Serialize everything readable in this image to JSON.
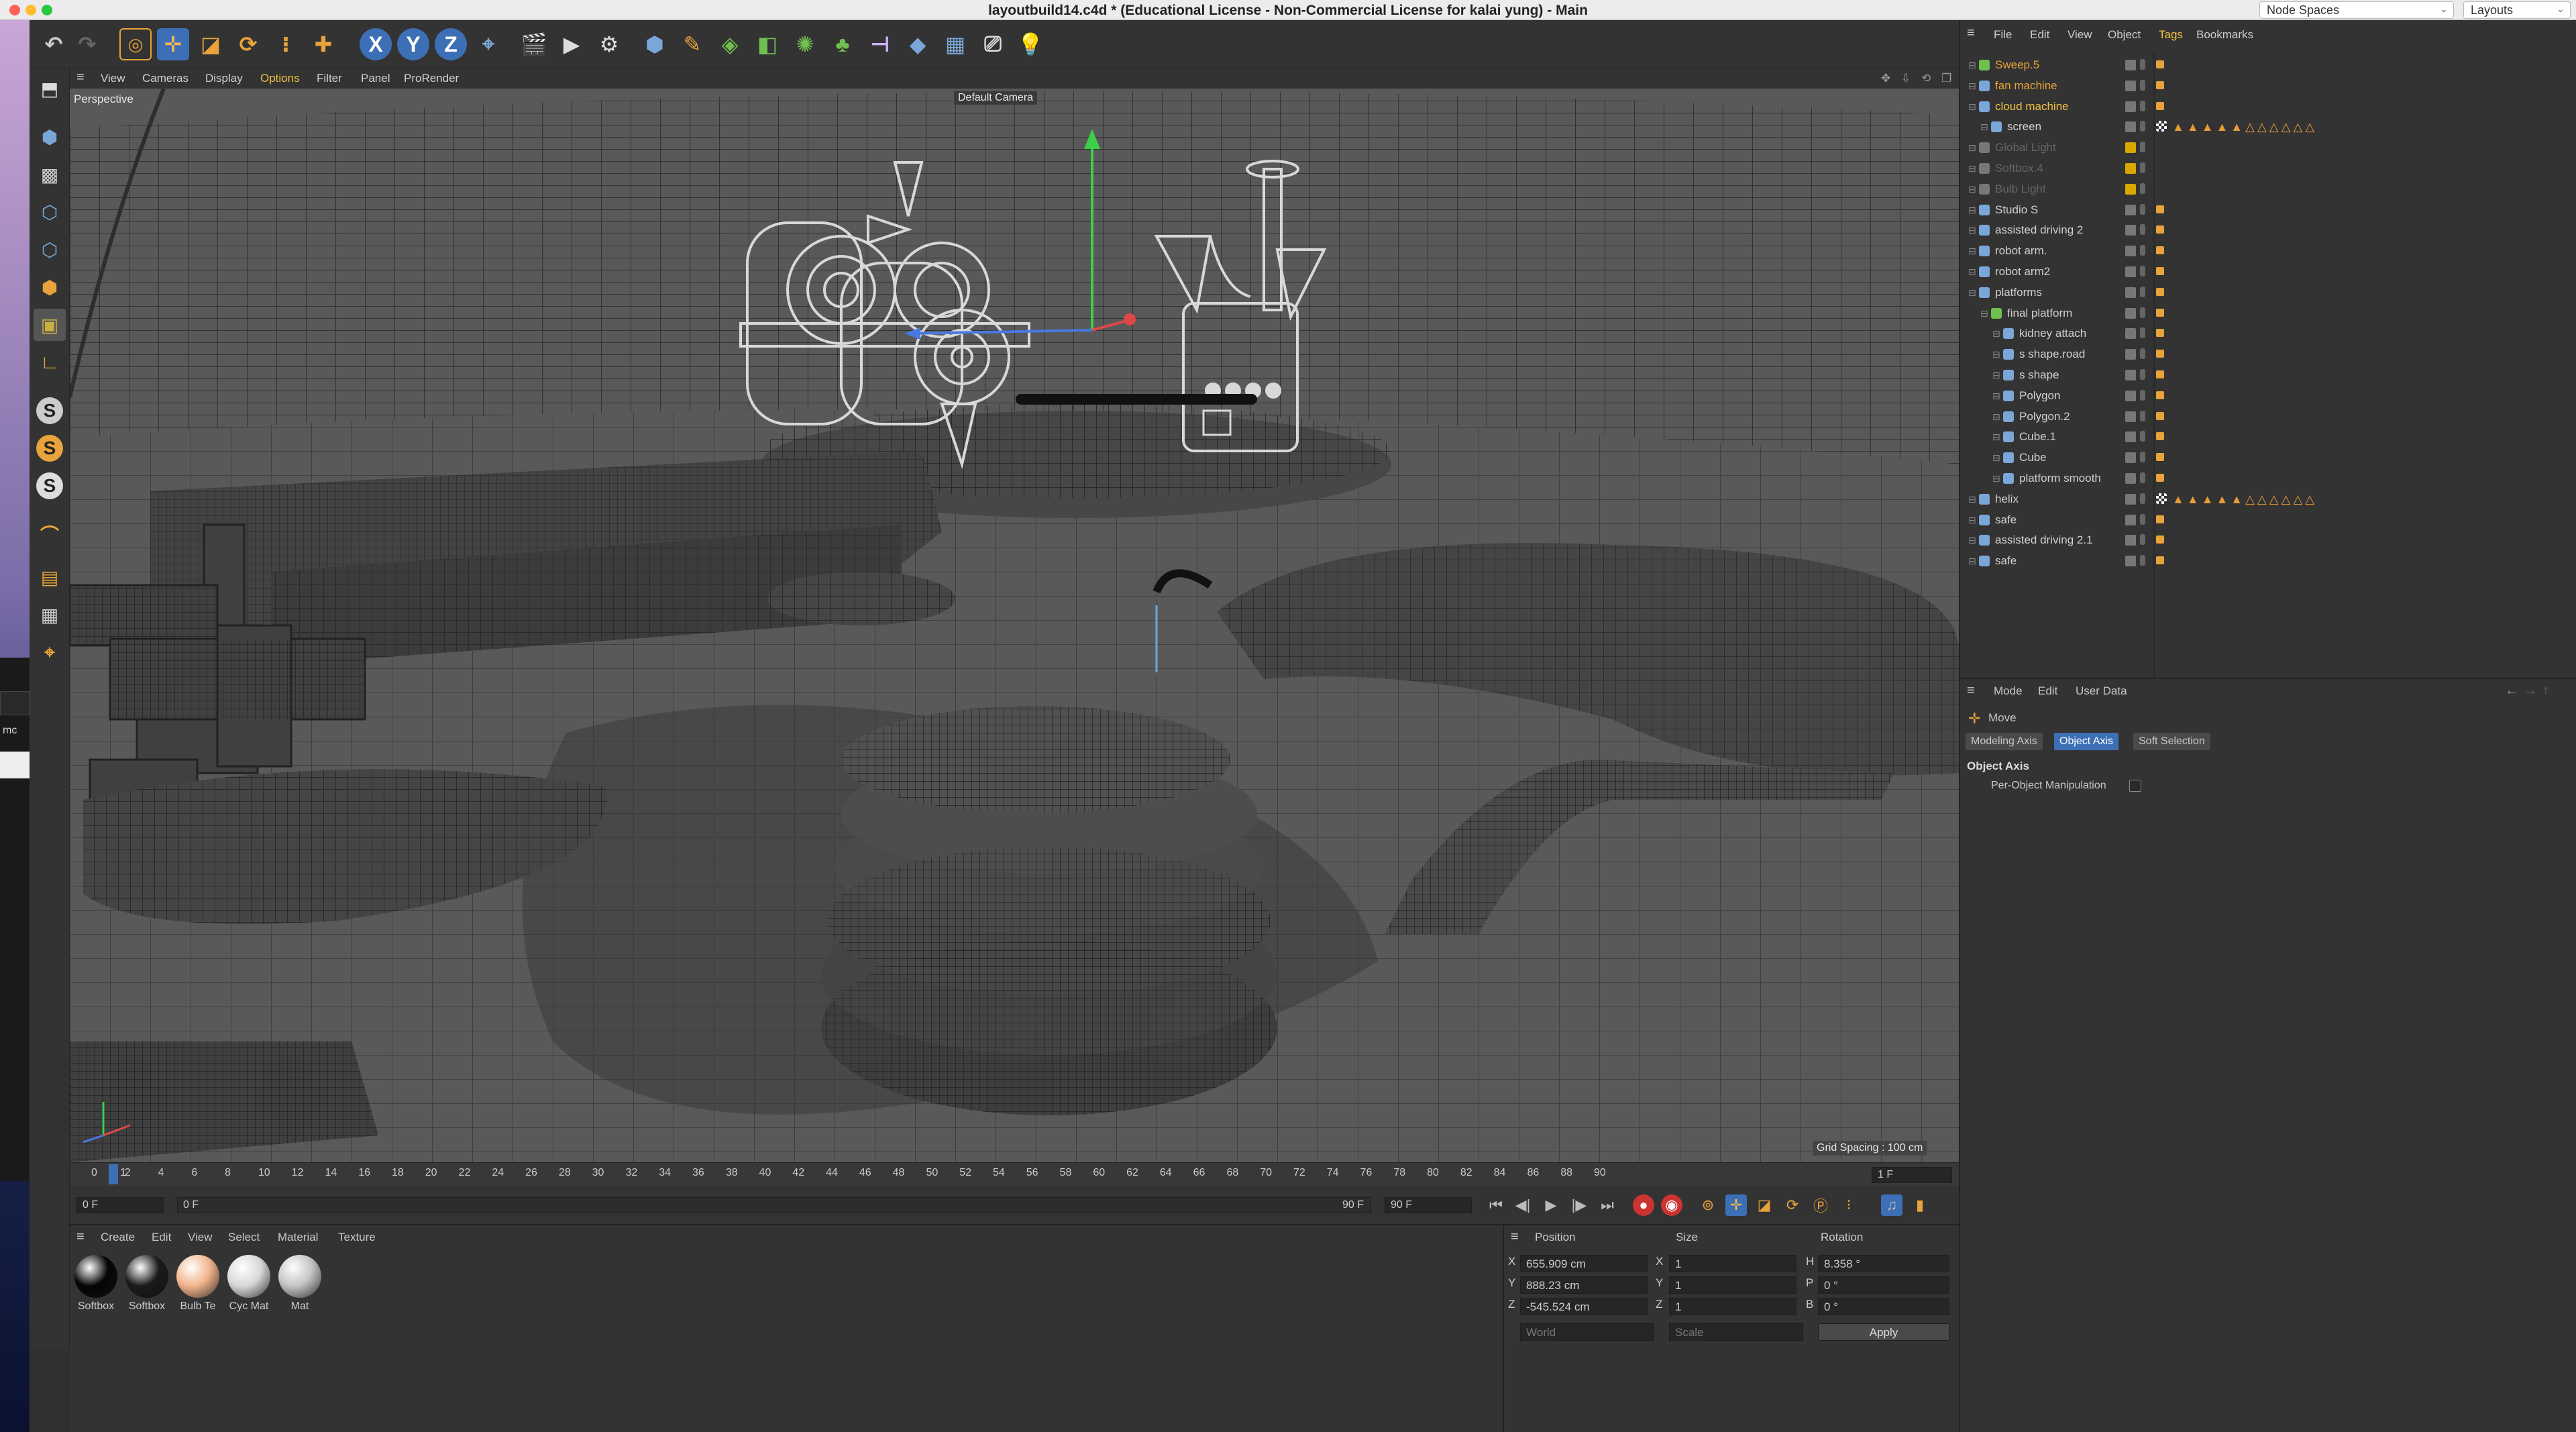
{
  "titlebar": {
    "title": "layoutbuild14.c4d * (Educational License - Non-Commercial License for kalai yung) - Main",
    "node_spaces": "Node Spaces",
    "layouts": "Layouts"
  },
  "toolbar": {
    "axis_x": "X",
    "axis_y": "Y",
    "axis_z": "Z"
  },
  "left_toolbar": {
    "s_label": "S"
  },
  "desktop": {
    "snippet": "mc"
  },
  "viewport": {
    "menu": [
      "View",
      "Cameras",
      "Display",
      "Options",
      "Filter",
      "Panel",
      "ProRender"
    ],
    "label": "Perspective",
    "camera": "Default Camera",
    "grid_spacing": "Grid Spacing : 100 cm"
  },
  "timeline": {
    "ticks": [
      "0",
      "2",
      "4",
      "6",
      "8",
      "10",
      "12",
      "14",
      "16",
      "18",
      "20",
      "22",
      "24",
      "26",
      "28",
      "30",
      "32",
      "34",
      "36",
      "38",
      "40",
      "42",
      "44",
      "46",
      "48",
      "50",
      "52",
      "54",
      "56",
      "58",
      "60",
      "62",
      "64",
      "66",
      "68",
      "70",
      "72",
      "74",
      "76",
      "78",
      "80",
      "82",
      "84",
      "86",
      "88",
      "90"
    ],
    "current_marker": "1",
    "current_frame_field": "1 F",
    "start_field": "0 F",
    "min_field": "0 F",
    "end_field": "90 F",
    "max_field": "90 F"
  },
  "materials": {
    "menu": [
      "Create",
      "Edit",
      "View",
      "Select",
      "Material",
      "Texture"
    ],
    "items": [
      {
        "label": "Softbox",
        "color": "#050505"
      },
      {
        "label": "Softbox",
        "color": "#1a1a1a"
      },
      {
        "label": "Bulb Te",
        "color": "#f2b48c"
      },
      {
        "label": "Cyc Mat",
        "color": "#d8d8d8"
      },
      {
        "label": "Mat",
        "color": "#c4c4c4"
      }
    ]
  },
  "coordinates": {
    "headers": {
      "position": "Position",
      "size": "Size",
      "rotation": "Rotation"
    },
    "rows": [
      {
        "axis": "X",
        "pos": "655.909 cm",
        "size_axis": "X",
        "size": "1",
        "rot_axis": "H",
        "rot": "8.358 °"
      },
      {
        "axis": "Y",
        "pos": "888.23 cm",
        "size_axis": "Y",
        "size": "1",
        "rot_axis": "P",
        "rot": "0 °"
      },
      {
        "axis": "Z",
        "pos": "-545.524 cm",
        "size_axis": "Z",
        "size": "1",
        "rot_axis": "B",
        "rot": "0 °"
      }
    ],
    "space": "World",
    "mode": "Scale",
    "apply": "Apply"
  },
  "object_manager": {
    "menu": [
      "File",
      "Edit",
      "View",
      "Object",
      "Tags",
      "Bookmarks"
    ],
    "objects": [
      {
        "name": "Sweep.5",
        "indent": 0,
        "color": "#e8a33a",
        "dim": false,
        "icon": "#6fc04f"
      },
      {
        "name": "fan machine",
        "indent": 0,
        "color": "#e8a33a",
        "dim": false,
        "icon": "#7aa7d8"
      },
      {
        "name": "cloud machine",
        "indent": 0,
        "color": "#f0c040",
        "dim": false,
        "icon": "#7aa7d8"
      },
      {
        "name": "screen",
        "indent": 1,
        "color": "#d0d0d0",
        "dim": false,
        "icon": "#7aa7d8"
      },
      {
        "name": "Global Light",
        "indent": 0,
        "color": "#666666",
        "dim": true,
        "icon": "#777777"
      },
      {
        "name": "Softbox.4",
        "indent": 0,
        "color": "#666666",
        "dim": true,
        "icon": "#777777"
      },
      {
        "name": "Bulb Light",
        "indent": 0,
        "color": "#666666",
        "dim": true,
        "icon": "#777777"
      },
      {
        "name": "Studio S",
        "indent": 0,
        "color": "#d0d0d0",
        "dim": false,
        "icon": "#7aa7d8"
      },
      {
        "name": "assisted driving 2",
        "indent": 0,
        "color": "#d0d0d0",
        "dim": false,
        "icon": "#7aa7d8"
      },
      {
        "name": "robot arm.",
        "indent": 0,
        "color": "#d0d0d0",
        "dim": false,
        "icon": "#7aa7d8"
      },
      {
        "name": "robot arm2",
        "indent": 0,
        "color": "#d0d0d0",
        "dim": false,
        "icon": "#7aa7d8"
      },
      {
        "name": "platforms",
        "indent": 0,
        "color": "#d0d0d0",
        "dim": false,
        "icon": "#7aa7d8"
      },
      {
        "name": "final platform",
        "indent": 1,
        "color": "#d0d0d0",
        "dim": false,
        "icon": "#6fc04f"
      },
      {
        "name": "kidney attach",
        "indent": 2,
        "color": "#d0d0d0",
        "dim": false,
        "icon": "#7aa7d8"
      },
      {
        "name": "s shape.road",
        "indent": 2,
        "color": "#d0d0d0",
        "dim": false,
        "icon": "#7aa7d8"
      },
      {
        "name": "s shape",
        "indent": 2,
        "color": "#d0d0d0",
        "dim": false,
        "icon": "#7aa7d8"
      },
      {
        "name": "Polygon",
        "indent": 2,
        "color": "#d0d0d0",
        "dim": false,
        "icon": "#7aa7d8"
      },
      {
        "name": "Polygon.2",
        "indent": 2,
        "color": "#d0d0d0",
        "dim": false,
        "icon": "#7aa7d8"
      },
      {
        "name": "Cube.1",
        "indent": 2,
        "color": "#d0d0d0",
        "dim": false,
        "icon": "#7aa7d8"
      },
      {
        "name": "Cube",
        "indent": 2,
        "color": "#d0d0d0",
        "dim": false,
        "icon": "#7aa7d8"
      },
      {
        "name": "platform smooth",
        "indent": 2,
        "color": "#d0d0d0",
        "dim": false,
        "icon": "#7aa7d8"
      },
      {
        "name": "helix",
        "indent": 0,
        "color": "#d0d0d0",
        "dim": false,
        "icon": "#7aa7d8"
      },
      {
        "name": "safe",
        "indent": 0,
        "color": "#d0d0d0",
        "dim": false,
        "icon": "#7aa7d8"
      },
      {
        "name": "assisted driving 2.1",
        "indent": 0,
        "color": "#d0d0d0",
        "dim": false,
        "icon": "#7aa7d8"
      },
      {
        "name": "safe",
        "indent": 0,
        "color": "#d0d0d0",
        "dim": false,
        "icon": "#7aa7d8"
      }
    ]
  },
  "attributes": {
    "menu": [
      "Mode",
      "Edit",
      "User Data"
    ],
    "tool": "Move",
    "tabs": [
      "Modeling Axis",
      "Object Axis",
      "Soft Selection"
    ],
    "active_tab": "Object Axis",
    "section": "Object Axis",
    "option": "Per-Object Manipulation",
    "option_checked": false
  },
  "colors": {
    "accent": "#e8a33a",
    "selected_tab": "#3d6fb6",
    "axis_x": "#e04848",
    "axis_y": "#48d048",
    "axis_z": "#4878e0"
  }
}
